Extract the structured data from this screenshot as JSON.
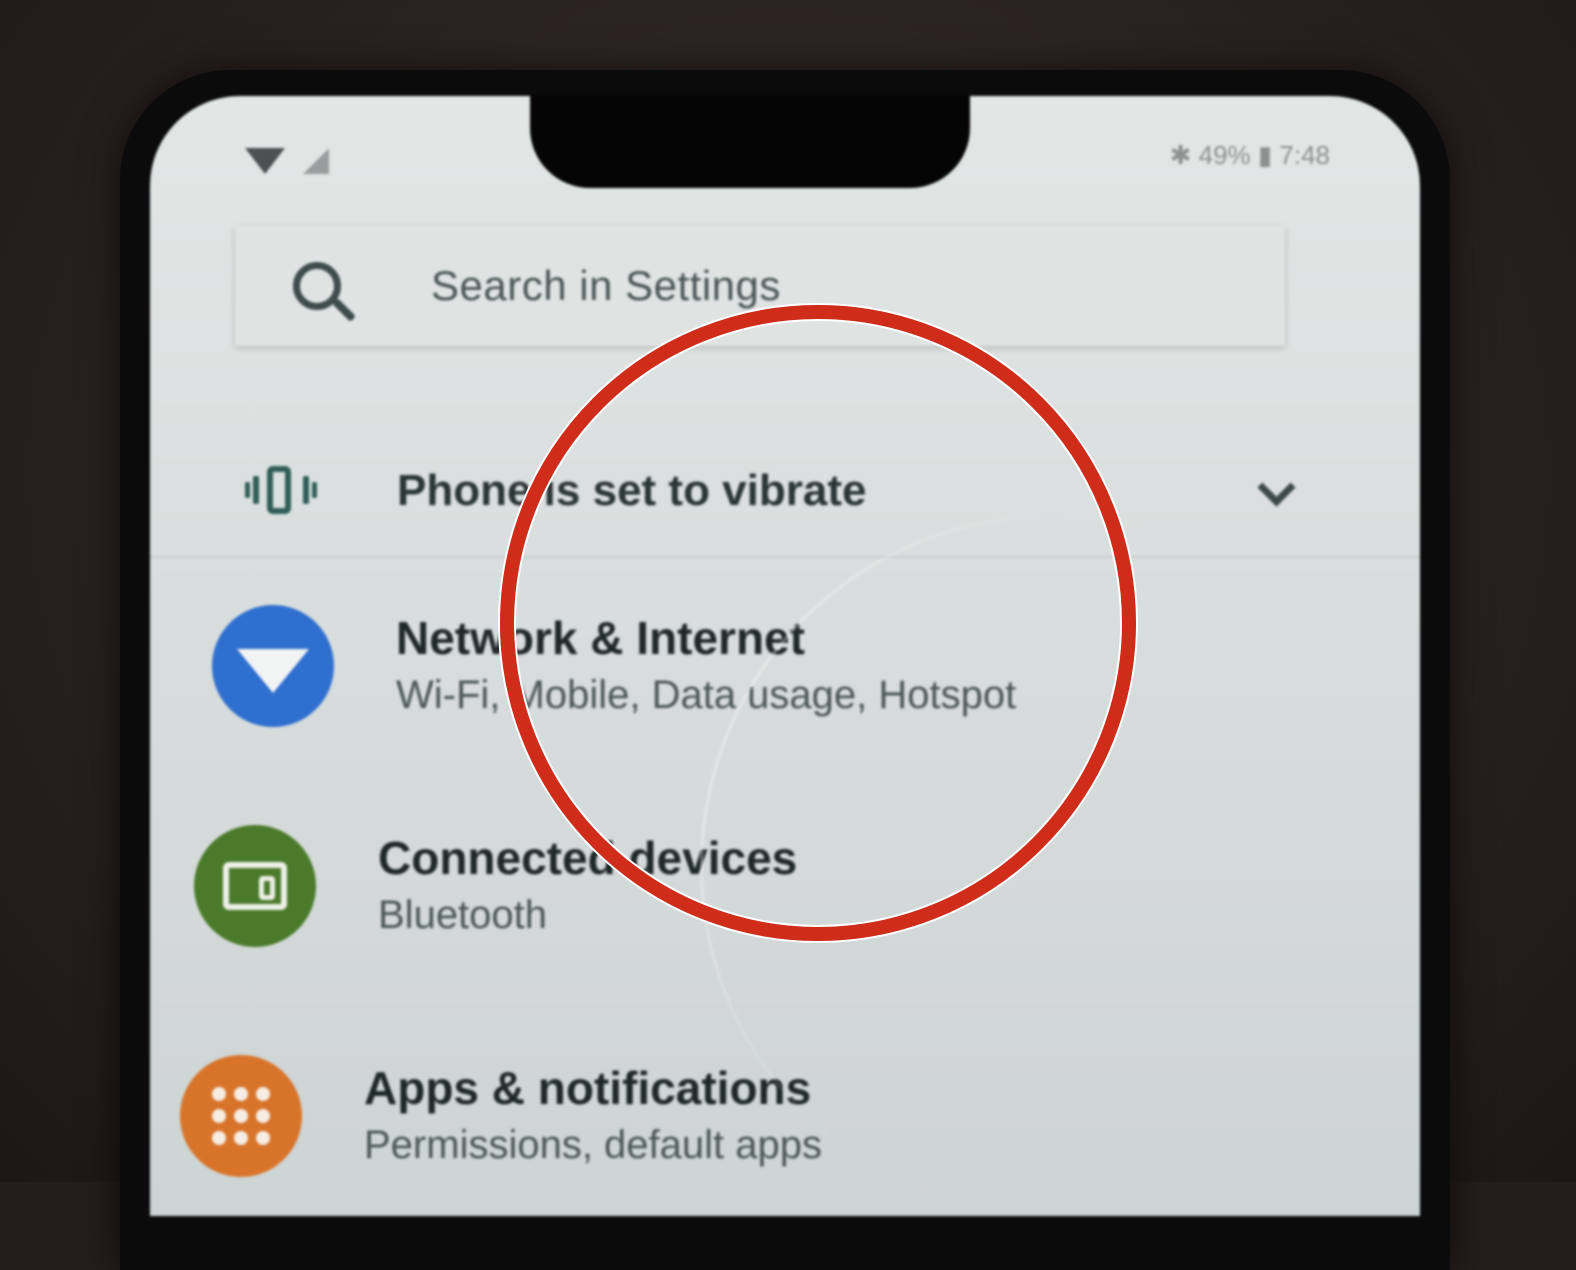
{
  "status_bar": {
    "right_text": "✱ 49% ▮ 7:48"
  },
  "search": {
    "placeholder": "Search in Settings"
  },
  "condition": {
    "text": "Phone is set to vibrate"
  },
  "settings": [
    {
      "title": "Network & Internet",
      "subtitle": "Wi-Fi, Mobile, Data usage, Hotspot",
      "icon": "wifi-icon",
      "color": "#2f6fcf"
    },
    {
      "title": "Connected devices",
      "subtitle": "Bluetooth",
      "icon": "connected-devices-icon",
      "color": "#4a7a2a"
    },
    {
      "title": "Apps & notifications",
      "subtitle": "Permissions, default apps",
      "icon": "apps-grid-icon",
      "color": "#d8742a"
    }
  ],
  "annotation": {
    "ring_color": "#cf2c1a"
  }
}
